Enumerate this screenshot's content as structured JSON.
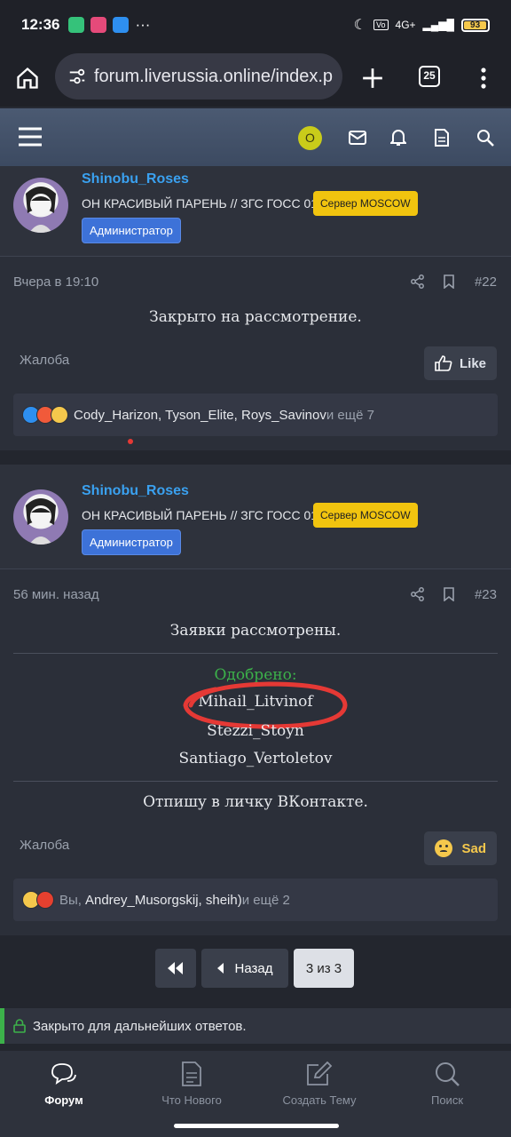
{
  "statusbar": {
    "time": "12:36",
    "dots": "···",
    "network": "4G+",
    "battery": "93"
  },
  "browser": {
    "url": "forum.liverussia.online/index.p",
    "tab_count": "25"
  },
  "nav": {
    "user_initial": "O"
  },
  "posts": [
    {
      "username": "Shinobu_Roses",
      "user_title": "ОН КРАСИВЫЙ ПАРЕНЬ // ЗГС ГОСС 01",
      "server_badge": "Сервер MOSCOW",
      "role_badge": "Администратор",
      "time": "Вчера в 19:10",
      "number": "#22",
      "body": [
        "Закрыто на рассмотрение."
      ],
      "report": "Жалоба",
      "react_label": "Like",
      "reactions": {
        "users": "Cody_Harizon, Tyson_Elite, Roys_Savinov",
        "more": " и ещё 7"
      }
    },
    {
      "username": "Shinobu_Roses",
      "user_title": "ОН КРАСИВЫЙ ПАРЕНЬ // ЗГС ГОСС 01",
      "server_badge": "Сервер MOSCOW",
      "role_badge": "Администратор",
      "time": "56 мин. назад",
      "number": "#23",
      "body": [
        "Заявки рассмотрены.",
        "Одобрено:",
        "Mihail_Litvinof",
        "Stezzi_Stoyn",
        "Santiago_Vertoletov",
        "Отпишу в личку ВКонтакте."
      ],
      "report": "Жалоба",
      "react_label": "Sad",
      "reactions": {
        "you": "Вы, ",
        "users": "Andrey_Musorgskij, sheih)",
        "more": " и ещё 2"
      }
    }
  ],
  "pagination": {
    "back": "Назад",
    "page": "3 из 3"
  },
  "closed_notice": "Закрыто для дальнейших ответов.",
  "tabs": [
    {
      "label": "Форум",
      "icon": "chat-icon"
    },
    {
      "label": "Что Нового",
      "icon": "document-icon"
    },
    {
      "label": "Создать Тему",
      "icon": "edit-icon"
    },
    {
      "label": "Поиск",
      "icon": "search-icon"
    }
  ],
  "colors": {
    "accent_username": "#3aa1f0",
    "approved": "#3cb14a",
    "server_badge": "#f1c40f",
    "admin_badge": "#3d72d8",
    "annotation_circle": "#e53935"
  }
}
